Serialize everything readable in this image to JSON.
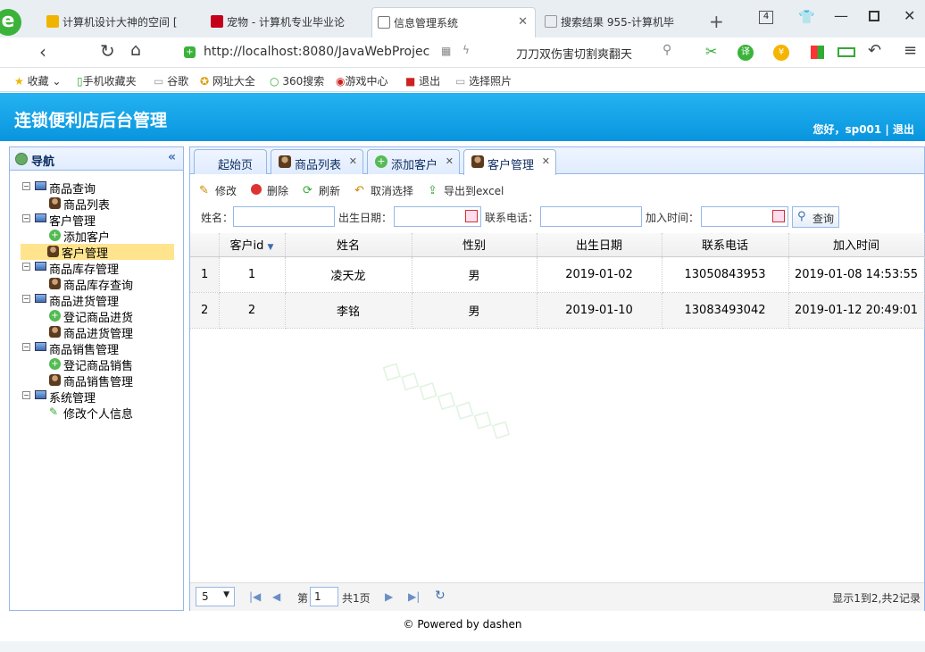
{
  "browser": {
    "tabs": [
      {
        "label": "计算机设计大神的空间 [",
        "color": "#f0b400"
      },
      {
        "label": "宠物 - 计算机专业毕业论",
        "color": "#c4001a"
      },
      {
        "label": "信息管理系统",
        "color": "#777"
      },
      {
        "label": "搜索结果 955-计算机毕",
        "color": "#999"
      }
    ],
    "tab_count": "4",
    "url": "http://localhost:8080/JavaWebProjec",
    "search": "刀刀双伤害切割爽翻天"
  },
  "bookmarks": [
    "收藏",
    "手机收藏夹",
    "谷歌",
    "网址大全",
    "360搜索",
    "游戏中心",
    "退出",
    "选择照片"
  ],
  "app": {
    "title": "连锁便利店后台管理",
    "user": "您好，sp001 | 退出"
  },
  "nav": {
    "title": "导航",
    "items": [
      {
        "label": "商品查询",
        "level": 0
      },
      {
        "label": "商品列表",
        "level": 1
      },
      {
        "label": "客户管理",
        "level": 0
      },
      {
        "label": "添加客户",
        "level": 1
      },
      {
        "label": "客户管理",
        "level": 1
      },
      {
        "label": "商品库存管理",
        "level": 0
      },
      {
        "label": "商品库存查询",
        "level": 1
      },
      {
        "label": "商品进货管理",
        "level": 0
      },
      {
        "label": "登记商品进货",
        "level": 1
      },
      {
        "label": "商品进货管理",
        "level": 1
      },
      {
        "label": "商品销售管理",
        "level": 0
      },
      {
        "label": "登记商品销售",
        "level": 1
      },
      {
        "label": "商品销售管理",
        "level": 1
      },
      {
        "label": "系统管理",
        "level": 0
      },
      {
        "label": "修改个人信息",
        "level": 1
      }
    ]
  },
  "tabs": [
    "起始页",
    "商品列表",
    "添加客户",
    "客户管理"
  ],
  "toolbar": [
    "修改",
    "删除",
    "刷新",
    "取消选择",
    "导出到excel"
  ],
  "filters": {
    "name": "姓名：",
    "birth": "出生日期：",
    "phone": "联系电话：",
    "join": "加入时间：",
    "query": "查询"
  },
  "grid": {
    "columns": [
      "客户id",
      "姓名",
      "性别",
      "出生日期",
      "联系电话",
      "加入时间"
    ],
    "rows": [
      [
        "1",
        "1",
        "凌天龙",
        "男",
        "2019-01-02",
        "13050843953",
        "2019-01-08 14:53:55"
      ],
      [
        "2",
        "2",
        "李铭",
        "男",
        "2019-01-10",
        "13083493042",
        "2019-01-12 20:49:01"
      ]
    ]
  },
  "pager": {
    "size": "5",
    "page_prefix": "第",
    "page": "1",
    "page_suffix": "共1页",
    "info": "显示1到2,共2记录"
  },
  "footer": "© Powered by dashen"
}
